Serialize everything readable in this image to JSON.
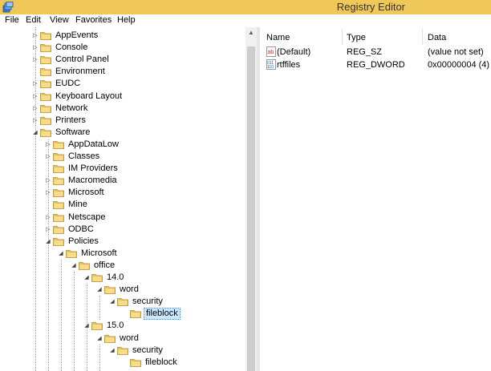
{
  "window": {
    "title": "Registry Editor"
  },
  "menu": [
    "File",
    "Edit",
    "View",
    "Favorites",
    "Help"
  ],
  "tree": [
    {
      "label": "AppEvents",
      "expander": "▷"
    },
    {
      "label": "Console",
      "expander": "▷"
    },
    {
      "label": "Control Panel",
      "expander": "▷"
    },
    {
      "label": "Environment",
      "expander": ""
    },
    {
      "label": "EUDC",
      "expander": "▷"
    },
    {
      "label": "Keyboard Layout",
      "expander": "▷"
    },
    {
      "label": "Network",
      "expander": "▷"
    },
    {
      "label": "Printers",
      "expander": "▷"
    },
    {
      "label": "Software",
      "expander": "◢"
    },
    {
      "label": "AppDataLow",
      "expander": "▷"
    },
    {
      "label": "Classes",
      "expander": "▷"
    },
    {
      "label": "IM Providers",
      "expander": ""
    },
    {
      "label": "Macromedia",
      "expander": "▷"
    },
    {
      "label": "Microsoft",
      "expander": "▷"
    },
    {
      "label": "Mine",
      "expander": ""
    },
    {
      "label": "Netscape",
      "expander": "▷"
    },
    {
      "label": "ODBC",
      "expander": "▷"
    },
    {
      "label": "Policies",
      "expander": "◢"
    },
    {
      "label": "Microsoft",
      "expander": "◢"
    },
    {
      "label": "office",
      "expander": "◢"
    },
    {
      "label": "14.0",
      "expander": "◢"
    },
    {
      "label": "word",
      "expander": "◢"
    },
    {
      "label": "security",
      "expander": "◢"
    },
    {
      "label": "fileblock",
      "expander": ""
    },
    {
      "label": "15.0",
      "expander": "◢"
    },
    {
      "label": "word",
      "expander": "◢"
    },
    {
      "label": "security",
      "expander": "◢"
    },
    {
      "label": "fileblock",
      "expander": ""
    }
  ],
  "list": {
    "columns": {
      "name": "Name",
      "type": "Type",
      "data": "Data"
    },
    "rows": [
      {
        "icon": "string-value-icon",
        "icon_text": "ab",
        "name": "(Default)",
        "type": "REG_SZ",
        "data": "(value not set)"
      },
      {
        "icon": "binary-value-icon",
        "icon_text": "011",
        "name": "rtffiles",
        "type": "REG_DWORD",
        "data": "0x00000004 (4)"
      }
    ]
  },
  "colors": {
    "titlebar": "#f0c85a",
    "folder": "#e8c25a",
    "selection": "#cce8ff"
  }
}
